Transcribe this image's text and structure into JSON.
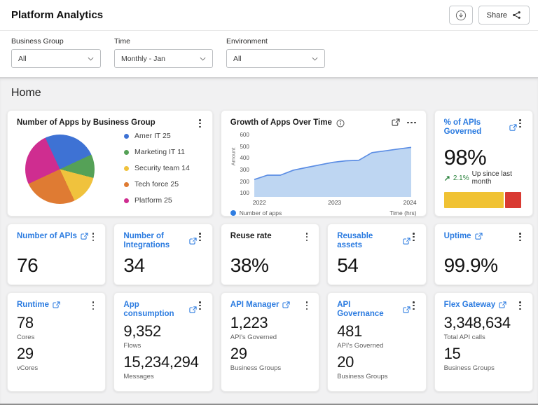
{
  "header": {
    "title": "Platform Analytics",
    "share_label": "Share"
  },
  "filters": {
    "items": [
      {
        "label": "Business Group",
        "value": "All"
      },
      {
        "label": "Time",
        "value": "Monthly - Jan"
      },
      {
        "label": "Environment",
        "value": "All"
      }
    ]
  },
  "page": {
    "section_title": "Home"
  },
  "pie_card": {
    "title": "Number of Apps by Business Group",
    "legend": [
      {
        "label": "Amer IT 25",
        "color": "#3e72d4"
      },
      {
        "label": "Marketing IT 11",
        "color": "#55a157"
      },
      {
        "label": "Security team 14",
        "color": "#f0c23d"
      },
      {
        "label": "Tech force 25",
        "color": "#df7b33"
      },
      {
        "label": "Platform 25",
        "color": "#cf2d90"
      }
    ]
  },
  "growth_card": {
    "title": "Growth of Apps Over Time",
    "y_axis_label": "Amount",
    "legend_label": "Number of apps",
    "legend_color": "#2f7de1",
    "time_label": "Time (hrs)"
  },
  "governed_card": {
    "title": "% of APIs Governed",
    "value": "98%",
    "trend_pct": "2.1%",
    "trend_text": "Up since last month",
    "bar": {
      "yellow_color": "#f0c233",
      "red_color": "#d93a32",
      "yellow_pct": 75,
      "red_pct": 21
    }
  },
  "kpi_cards": [
    {
      "title": "Number of APIs",
      "value": "76"
    },
    {
      "title": "Number of Integrations",
      "value": "34"
    },
    {
      "title": "Reuse rate",
      "value": "38%"
    },
    {
      "title": "Reusable assets",
      "value": "54"
    },
    {
      "title": "Uptime",
      "value": "99.9%"
    }
  ],
  "detail_cards": [
    {
      "title": "Runtime",
      "value1": "78",
      "label1": "Cores",
      "value2": "29",
      "label2": "vCores"
    },
    {
      "title": "App consumption",
      "value1": "9,352",
      "label1": "Flows",
      "value2": "15,234,294",
      "label2": "Messages"
    },
    {
      "title": "API Manager",
      "value1": "1,223",
      "label1": "API's Governed",
      "value2": "29",
      "label2": "Business Groups"
    },
    {
      "title": "API Governance",
      "value1": "481",
      "label1": "API's Governed",
      "value2": "20",
      "label2": "Business Groups"
    },
    {
      "title": "Flex Gateway",
      "value1": "3,348,634",
      "label1": "Total API calls",
      "value2": "15",
      "label2": "Business Groups"
    }
  ],
  "chart_data": [
    {
      "type": "pie",
      "title": "Number of Apps by Business Group",
      "labels": [
        "Amer IT",
        "Marketing IT",
        "Security team",
        "Tech force",
        "Platform"
      ],
      "values": [
        25,
        11,
        14,
        25,
        25
      ],
      "colors": [
        "#3e72d4",
        "#55a157",
        "#f0c23d",
        "#df7b33",
        "#cf2d90"
      ],
      "start_angle_deg": -25,
      "legend_position": "right"
    },
    {
      "type": "area",
      "title": "Growth of Apps Over Time",
      "series": [
        {
          "name": "Number of apps",
          "values": [
            215,
            252,
            252,
            295,
            318,
            340,
            362,
            375,
            380,
            445,
            460,
            476,
            490
          ]
        }
      ],
      "x_tick_labels": [
        "2022",
        "2023",
        "2024"
      ],
      "xlabel": "Time (hrs)",
      "ylabel": "Amount",
      "ylim": [
        100,
        600
      ],
      "yticks": [
        100,
        200,
        300,
        400,
        500,
        600
      ],
      "baseline_value": 78,
      "line_color": "#5b8de4",
      "fill_color": "#bed6f2",
      "grid": false,
      "legend_position": "bottom-left"
    }
  ]
}
